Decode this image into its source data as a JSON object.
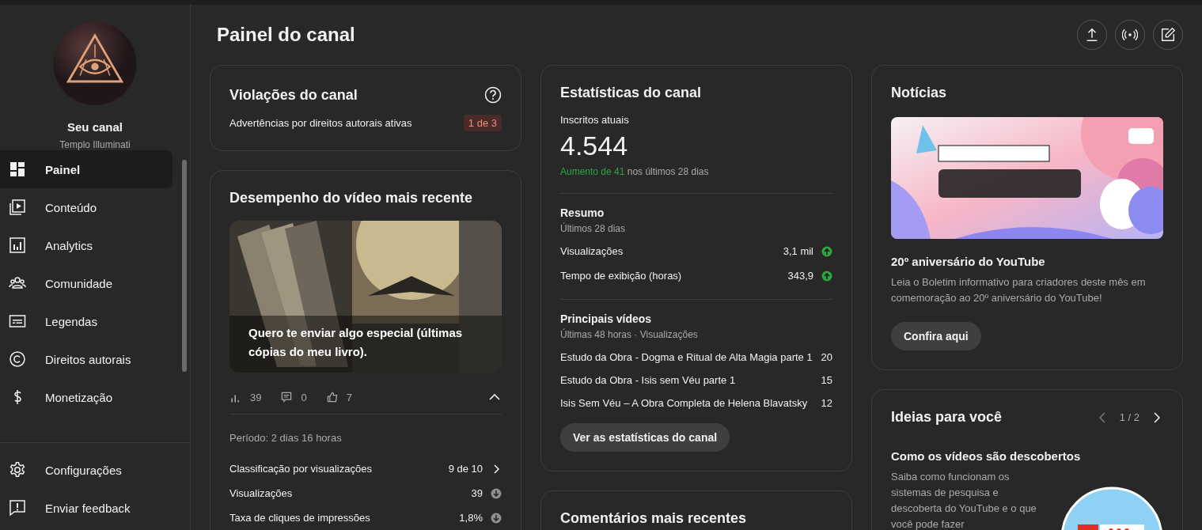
{
  "sidebar": {
    "channel_label": "Seu canal",
    "channel_name": "Templo Illuminati",
    "nav": [
      {
        "label": "Painel",
        "kind": "dashboard",
        "selected": true
      },
      {
        "label": "Conteúdo",
        "kind": "content",
        "selected": false
      },
      {
        "label": "Analytics",
        "kind": "analytics",
        "selected": false
      },
      {
        "label": "Comunidade",
        "kind": "community",
        "selected": false
      },
      {
        "label": "Legendas",
        "kind": "subtitles",
        "selected": false
      },
      {
        "label": "Direitos autorais",
        "kind": "copyright",
        "selected": false
      },
      {
        "label": "Monetização",
        "kind": "money",
        "selected": false
      }
    ],
    "footer": [
      {
        "label": "Configurações",
        "kind": "settings"
      },
      {
        "label": "Enviar feedback",
        "kind": "feedback"
      }
    ]
  },
  "header": {
    "title": "Painel do canal",
    "actions": [
      {
        "kind": "upload"
      },
      {
        "kind": "live"
      },
      {
        "kind": "edit"
      }
    ]
  },
  "violations": {
    "title": "Violações do canal",
    "rows": [
      {
        "label": "Advertências por direitos autorais ativas",
        "badge": "1 de 3"
      }
    ]
  },
  "latest_video": {
    "title": "Desempenho do vídeo mais recente",
    "video_title": "Quero te enviar algo especial (últimas cópias do meu livro).",
    "stats": [
      {
        "kind": "views",
        "value": "39"
      },
      {
        "kind": "comments",
        "value": "0"
      },
      {
        "kind": "likes",
        "value": "7"
      }
    ],
    "expanded": true,
    "period": "Período: 2 dias 16 horas",
    "metrics": [
      {
        "label": "Classificação por visualizações",
        "value": "9 de 10",
        "kind": "link"
      },
      {
        "label": "Visualizações",
        "value": "39",
        "kind": "down"
      },
      {
        "label": "Taxa de cliques de impressões",
        "value": "1,8%",
        "kind": "down"
      }
    ]
  },
  "channel_stats": {
    "title": "Estatísticas do canal",
    "subscribers_label": "Inscritos atuais",
    "subscribers": "4.544",
    "change": "Aumento de 41",
    "change_rest": "nos últimos 28 dias",
    "summary": {
      "title": "Resumo",
      "subtitle": "Últimos 28 dias",
      "rows": [
        {
          "label": "Visualizações",
          "value": "3,1 mil",
          "kind": "up"
        },
        {
          "label": "Tempo de exibição (horas)",
          "value": "343,9",
          "kind": "up"
        }
      ]
    },
    "top_videos": {
      "title": "Principais vídeos",
      "subtitle": "Últimas 48 horas · Visualizações",
      "rows": [
        {
          "title": "Estudo da Obra - Dogma e Ritual de Alta Magia parte 1",
          "views": "20"
        },
        {
          "title": "Estudo da Obra - Isis sem Véu parte 1",
          "views": "15"
        },
        {
          "title": "Isis Sem Véu – A Obra Completa de Helena Blavatsky",
          "views": "12"
        }
      ]
    },
    "button": "Ver as estatísticas do canal"
  },
  "comments": {
    "title": "Comentários mais recentes"
  },
  "news": {
    "title": "Notícias",
    "headline": "20º aniversário do YouTube",
    "body": "Leia o Boletim informativo para criadores deste mês em comemoração ao 20º aniversário do YouTube!",
    "button": "Confira aqui"
  },
  "ideas": {
    "title": "Ideias para você",
    "pager": "1 / 2",
    "headline": "Como os vídeos são descobertos",
    "body": "Saiba como funcionam os sistemas de pesquisa e descoberta do YouTube e o que você pode fazer"
  }
}
